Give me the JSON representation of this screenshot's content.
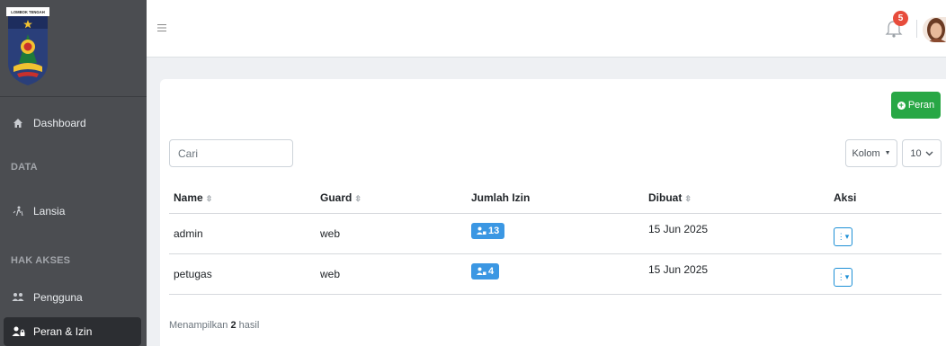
{
  "sidebar": {
    "logo_text": "LOMBOK TENGAH",
    "items": [
      {
        "label": "Dashboard",
        "icon": "home-icon"
      },
      {
        "label": "Lansia",
        "icon": "elderly-icon"
      },
      {
        "label": "Pengguna",
        "icon": "users-icon"
      },
      {
        "label": "Peran & Izin",
        "icon": "user-lock-icon",
        "active": true
      }
    ],
    "sections": [
      "DATA",
      "HAK AKSES"
    ]
  },
  "topbar": {
    "notification_count": "5"
  },
  "toolbar": {
    "add_label": "Peran",
    "search_placeholder": "Cari",
    "columns_label": "Kolom",
    "page_size": "10"
  },
  "table": {
    "headers": {
      "name": "Name",
      "guard": "Guard",
      "izin": "Jumlah Izin",
      "dibuat": "Dibuat",
      "aksi": "Aksi"
    },
    "rows": [
      {
        "name": "admin",
        "guard": "web",
        "izin": "13",
        "dibuat": "15 Jun 2025"
      },
      {
        "name": "petugas",
        "guard": "web",
        "izin": "4",
        "dibuat": "15 Jun 2025"
      }
    ]
  },
  "summary": {
    "prefix": "Menampilkan",
    "count": "2",
    "suffix": "hasil"
  },
  "colors": {
    "sidebar": "#4b4d51",
    "primary_green": "#28a745",
    "info_blue": "#3b97e3",
    "badge_red": "#e74c3c"
  }
}
